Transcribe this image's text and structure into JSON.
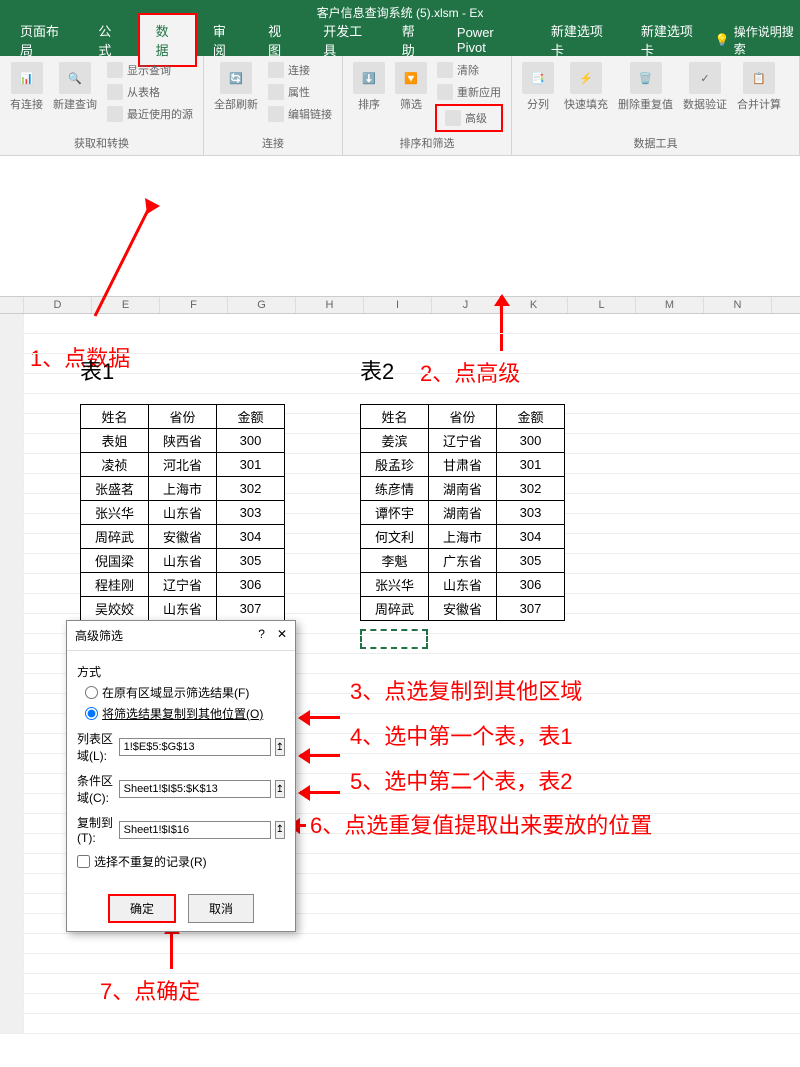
{
  "title": "客户信息查询系统 (5).xlsm - Ex",
  "tabs": [
    "页面布局",
    "公式",
    "数据",
    "审阅",
    "视图",
    "开发工具",
    "帮助",
    "Power Pivot",
    "新建选项卡",
    "新建选项卡"
  ],
  "active_tab_index": 2,
  "tell_me": "操作说明搜索",
  "ribbon_groups": {
    "g1": {
      "label": "获取和转换",
      "items": [
        "有连接",
        "新建查询"
      ],
      "side": [
        "显示查询",
        "从表格",
        "最近使用的源"
      ]
    },
    "g2": {
      "label": "连接",
      "items": [
        "全部刷新"
      ],
      "side": [
        "连接",
        "属性",
        "编辑链接"
      ]
    },
    "g3": {
      "label": "排序和筛选",
      "items": [
        "排序",
        "筛选"
      ],
      "side": [
        "清除",
        "重新应用",
        "高级"
      ]
    },
    "g4": {
      "label": "数据工具",
      "items": [
        "分列",
        "快速填充",
        "删除重复值",
        "数据验证",
        "合并计算"
      ]
    }
  },
  "cols": [
    "D",
    "E",
    "F",
    "G",
    "H",
    "I",
    "J",
    "K",
    "L",
    "M",
    "N"
  ],
  "table1": {
    "title": "表1",
    "headers": [
      "姓名",
      "省份",
      "金额"
    ],
    "rows": [
      [
        "表姐",
        "陕西省",
        "300"
      ],
      [
        "凌祯",
        "河北省",
        "301"
      ],
      [
        "张盛茗",
        "上海市",
        "302"
      ],
      [
        "张兴华",
        "山东省",
        "303"
      ],
      [
        "周碎武",
        "安徽省",
        "304"
      ],
      [
        "倪国梁",
        "山东省",
        "305"
      ],
      [
        "程桂刚",
        "辽宁省",
        "306"
      ],
      [
        "吴姣姣",
        "山东省",
        "307"
      ]
    ]
  },
  "table2": {
    "title": "表2",
    "headers": [
      "姓名",
      "省份",
      "金额"
    ],
    "rows": [
      [
        "姜滨",
        "辽宁省",
        "300"
      ],
      [
        "殷孟珍",
        "甘肃省",
        "301"
      ],
      [
        "练彦情",
        "湖南省",
        "302"
      ],
      [
        "谭怀宇",
        "湖南省",
        "303"
      ],
      [
        "何文利",
        "上海市",
        "304"
      ],
      [
        "李魁",
        "广东省",
        "305"
      ],
      [
        "张兴华",
        "山东省",
        "306"
      ],
      [
        "周碎武",
        "安徽省",
        "307"
      ]
    ]
  },
  "annotations": {
    "a1": "1、点数据",
    "a2": "2、点高级",
    "a3": "3、点选复制到其他区域",
    "a4": "4、选中第一个表，表1",
    "a5": "5、选中第二个表，表2",
    "a6": "6、点选重复值提取出来要放的位置",
    "a7": "7、点确定"
  },
  "dialog": {
    "title": "高级筛选",
    "section": "方式",
    "opt1": "在原有区域显示筛选结果(F)",
    "opt2": "将筛选结果复制到其他位置(O)",
    "list_label": "列表区域(L):",
    "list_value": "1!$E$5:$G$13",
    "cond_label": "条件区域(C):",
    "cond_value": "Sheet1!$I$5:$K$13",
    "copy_label": "复制到(T):",
    "copy_value": "Sheet1!$I$16",
    "unique": "选择不重复的记录(R)",
    "ok": "确定",
    "cancel": "取消"
  }
}
